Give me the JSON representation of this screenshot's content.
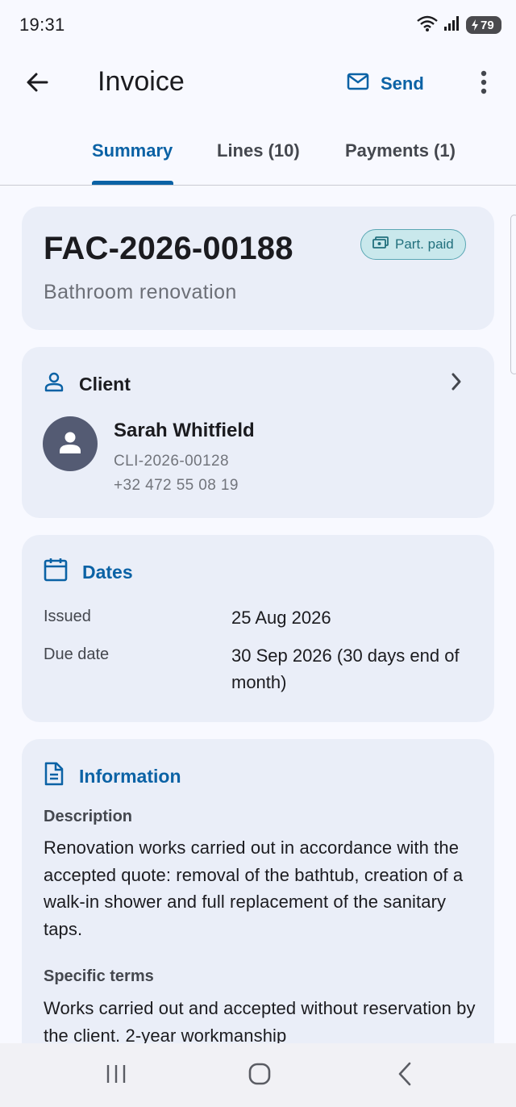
{
  "status_bar": {
    "time": "19:31",
    "battery_level": "79",
    "icons": [
      "wifi-icon",
      "signal-icon",
      "battery-charging-icon"
    ]
  },
  "app_bar": {
    "title": "Invoice",
    "send_label": "Send",
    "icons": [
      "back-arrow-icon",
      "mail-icon",
      "more-vert-icon"
    ]
  },
  "tabs": [
    {
      "label": "Summary",
      "active": true
    },
    {
      "label": "Lines (10)",
      "active": false
    },
    {
      "label": "Payments (1)",
      "active": false
    }
  ],
  "invoice": {
    "number": "FAC-2026-00188",
    "subtitle": "Bathroom renovation",
    "status": "Part. paid"
  },
  "client": {
    "section_title": "Client",
    "name": "Sarah Whitfield",
    "id": "CLI-2026-00128",
    "phone": "+32 472 55 08 19"
  },
  "dates": {
    "section_title": "Dates",
    "issued_label": "Issued",
    "issued_value": "25 Aug 2026",
    "due_label": "Due date",
    "due_value": "30 Sep 2026 (30 days end of month)"
  },
  "information": {
    "section_title": "Information",
    "description_label": "Description",
    "description_text": "Renovation works carried out in accordance with the accepted quote: removal of the bathtub, creation of a walk-in shower and full replacement of the sanitary taps.",
    "terms_label": "Specific terms",
    "terms_text": "Works carried out and accepted without reservation by the client. 2-year workmanship"
  },
  "colors": {
    "accent": "#0b62a5",
    "card_background": "#eaeef8",
    "badge_background": "#c9e8ec",
    "badge_text": "#22707d",
    "avatar": "#545b73"
  }
}
